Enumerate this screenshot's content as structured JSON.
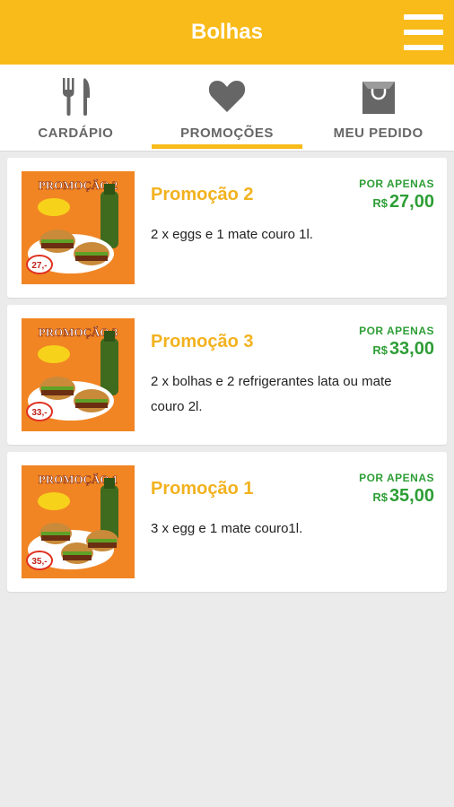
{
  "header": {
    "title": "Bolhas",
    "menu_icon": "hamburger-menu-icon"
  },
  "tabs": [
    {
      "label": "CARDÁPIO",
      "icon": "fork-knife-icon",
      "active": false
    },
    {
      "label": "PROMOÇÕES",
      "icon": "heart-icon",
      "active": true
    },
    {
      "label": "MEU PEDIDO",
      "icon": "shopping-bag-icon",
      "active": false
    }
  ],
  "promotions": [
    {
      "title": "Promoção 2",
      "description": "2 x eggs e 1 mate couro 1l.",
      "price_label": "POR APENAS",
      "currency": "R$",
      "price": "27,00",
      "image_banner": "PROMOÇÃO 2",
      "image_price": "27,-"
    },
    {
      "title": "Promoção 3",
      "description": "2 x bolhas e 2 refrigerantes lata ou mate couro 2l.",
      "price_label": "POR APENAS",
      "currency": "R$",
      "price": "33,00",
      "image_banner": "PROMOÇÃO 3",
      "image_price": "33,-"
    },
    {
      "title": "Promoção 1",
      "description": "3 x egg e 1 mate couro1l.",
      "price_label": "POR APENAS",
      "currency": "R$",
      "price": "35,00",
      "image_banner": "PROMOÇÃO 1",
      "image_price": "35,-"
    }
  ],
  "colors": {
    "accent": "#f9bb1a",
    "title": "#f2b21f",
    "price": "#2e9e36",
    "background": "#ebebeb"
  }
}
